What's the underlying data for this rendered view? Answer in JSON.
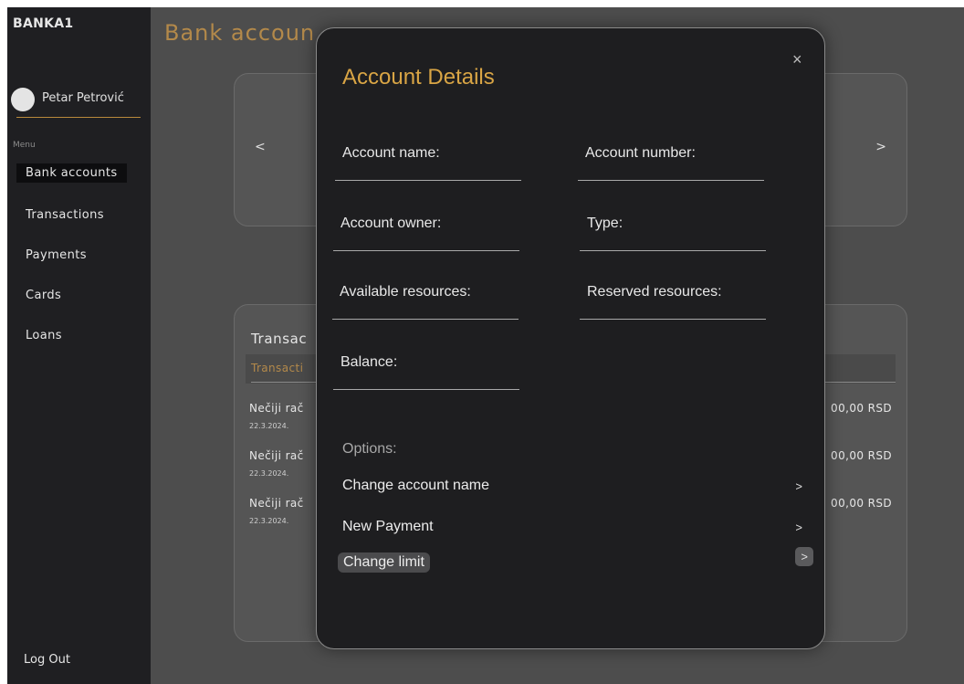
{
  "sidebar": {
    "brand": "BANKA1",
    "user_name": "Petar Petrović",
    "menu_label": "Menu",
    "items": [
      {
        "label": "Bank accounts"
      },
      {
        "label": "Transactions"
      },
      {
        "label": "Payments"
      },
      {
        "label": "Cards"
      },
      {
        "label": "Loans"
      }
    ],
    "logout": "Log Out"
  },
  "main": {
    "page_title": "Bank accoun",
    "carousel": {
      "prev": "<",
      "next": ">"
    },
    "transactions": {
      "title": "Transac",
      "header": "Transacti",
      "rows": [
        {
          "name": "Nečiji rač",
          "date": "22.3.2024.",
          "amount": "00,00 RSD"
        },
        {
          "name": "Nečiji rač",
          "date": "22.3.2024.",
          "amount": "00,00 RSD"
        },
        {
          "name": "Nečiji rač",
          "date": "22.3.2024.",
          "amount": "00,00 RSD"
        }
      ]
    }
  },
  "modal": {
    "title": "Account Details",
    "close": "×",
    "fields": {
      "account_name": "Account name:",
      "account_number": "Account number:",
      "account_owner": "Account owner:",
      "type": "Type:",
      "available_resources": "Available resources:",
      "reserved_resources": "Reserved resources:",
      "balance": "Balance:"
    },
    "options_label": "Options:",
    "options": [
      {
        "label": "Change account name",
        "chevron": ">"
      },
      {
        "label": "New Payment",
        "chevron": ">"
      },
      {
        "label": "Change limit",
        "chevron": ">"
      }
    ]
  }
}
